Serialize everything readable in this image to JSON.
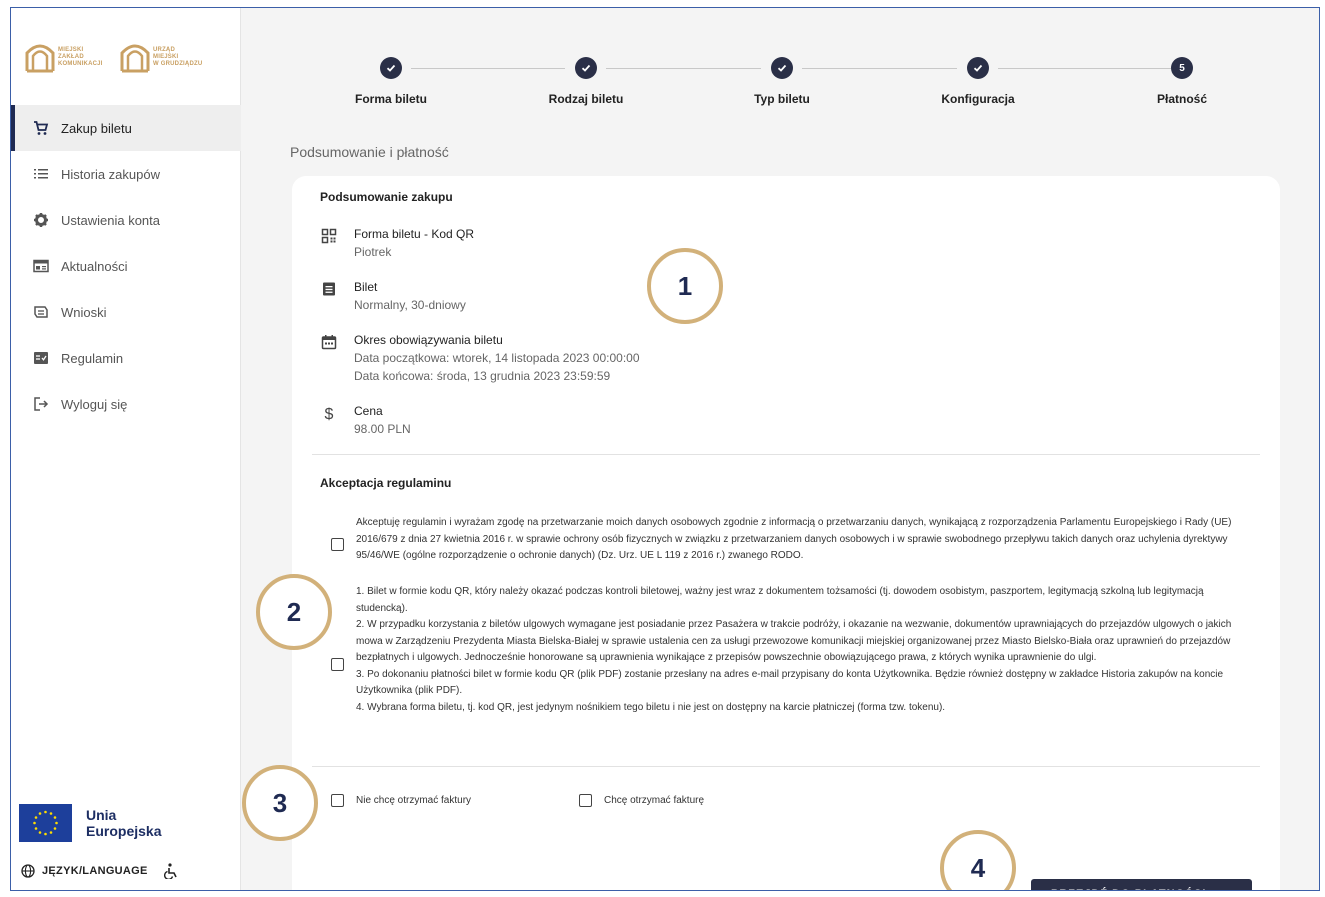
{
  "sidebar": {
    "logo1": [
      "MIEJSKI",
      "ZAKŁAD",
      "KOMUNIKACJI"
    ],
    "logo2": [
      "URZĄD",
      "MIEJSKI",
      "W GRUDZIĄDZU"
    ],
    "items": [
      {
        "label": "Zakup biletu",
        "icon": "cart-icon"
      },
      {
        "label": "Historia zakupów",
        "icon": "list-icon"
      },
      {
        "label": "Ustawienia konta",
        "icon": "gear-icon"
      },
      {
        "label": "Aktualności",
        "icon": "news-icon"
      },
      {
        "label": "Wnioski",
        "icon": "forms-icon"
      },
      {
        "label": "Regulamin",
        "icon": "regulations-icon"
      },
      {
        "label": "Wyloguj się",
        "icon": "logout-icon"
      }
    ],
    "eu_line1": "Unia",
    "eu_line2": "Europejska",
    "language": "JĘZYK/LANGUAGE"
  },
  "stepper": {
    "steps": [
      {
        "label": "Forma biletu",
        "state": "done"
      },
      {
        "label": "Rodzaj biletu",
        "state": "done"
      },
      {
        "label": "Typ biletu",
        "state": "done"
      },
      {
        "label": "Konfiguracja",
        "state": "done"
      },
      {
        "label": "Płatność",
        "state": "current",
        "number": "5"
      }
    ]
  },
  "page_title": "Podsumowanie i płatność",
  "summary": {
    "heading": "Podsumowanie zakupu",
    "items": [
      {
        "title": "Forma biletu - Kod QR",
        "lines": [
          "Piotrek"
        ],
        "icon": "qr-icon"
      },
      {
        "title": "Bilet",
        "lines": [
          "Normalny, 30-dniowy"
        ],
        "icon": "ticket-icon"
      },
      {
        "title": "Okres obowiązywania biletu",
        "lines": [
          "Data początkowa: wtorek, 14 listopada 2023 00:00:00",
          "Data końcowa: środa, 13 grudnia 2023 23:59:59"
        ],
        "icon": "calendar-icon"
      },
      {
        "title": "Cena",
        "lines": [
          "98.00 PLN"
        ],
        "icon": "dollar-icon"
      }
    ]
  },
  "terms": {
    "heading": "Akceptacja regulaminu",
    "consent": "Akceptuję regulamin i wyrażam zgodę na przetwarzanie moich danych osobowych zgodnie z informacją o przetwarzaniu danych, wynikającą z rozporządzenia Parlamentu Europejskiego i Rady (UE) 2016/679 z dnia 27 kwietnia 2016 r. w sprawie ochrony osób fizycznych w związku z przetwarzaniem danych osobowych i w sprawie swobodnego przepływu takich danych oraz uchylenia dyrektywy 95/46/WE (ogólne rozporządzenie o ochronie danych) (Dz. Urz. UE L 119 z 2016 r.) zwanego RODO.",
    "rules": [
      "1. Bilet w formie kodu QR, który należy okazać podczas kontroli biletowej, ważny jest wraz z dokumentem tożsamości (tj. dowodem osobistym, paszportem, legitymacją szkolną lub legitymacją studencką).",
      "2. W przypadku korzystania z biletów ulgowych wymagane jest posiadanie przez Pasażera w trakcie podróży, i okazanie na wezwanie, dokumentów uprawniających do przejazdów ulgowych o jakich mowa w Zarządzeniu Prezydenta Miasta Bielska-Białej w sprawie ustalenia cen za usługi przewozowe komunikacji miejskiej organizowanej przez Miasto Bielsko-Biała oraz uprawnień do przejazdów bezpłatnych i ulgowych. Jednocześnie honorowane są uprawnienia wynikające z przepisów powszechnie obowiązującego prawa, z których wynika uprawnienie do ulgi.",
      "3. Po dokonaniu płatności bilet w formie kodu QR (plik PDF) zostanie przesłany na adres e-mail przypisany do konta Użytkownika. Będzie również dostępny w zakładce Historia zakupów na koncie Użytkownika (plik PDF).",
      "4. Wybrana forma biletu, tj. kod QR, jest jedynym nośnikiem tego biletu i nie jest on dostępny na karcie płatniczej (forma tzw. tokenu)."
    ]
  },
  "invoice": {
    "no_invoice": "Nie chcę otrzymać faktury",
    "want_invoice": "Chcę otrzymać fakturę"
  },
  "pay_button": "PRZEJDŹ DO PŁATNOŚCI",
  "badges": [
    "1",
    "2",
    "3",
    "4"
  ],
  "colors": {
    "primary": "#2a2f47",
    "badge_border": "#d2b17a",
    "gold": "#c9a063"
  }
}
